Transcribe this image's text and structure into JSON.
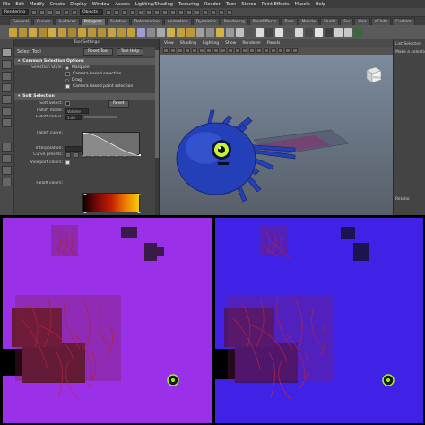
{
  "menu": {
    "items": [
      "File",
      "Edit",
      "Modify",
      "Create",
      "Display",
      "Window",
      "Assets",
      "Lighting/Shading",
      "Texturing",
      "Render",
      "Toon",
      "Stereo",
      "Paint Effects",
      "Muscle",
      "Help"
    ]
  },
  "statusline": {
    "mode": "Rendering",
    "selection_mask": "Objects"
  },
  "shelf": {
    "tabs": [
      "General",
      "Curves",
      "Surfaces",
      "Polygons",
      "Subdivs",
      "Deformation",
      "Animation",
      "Dynamics",
      "Rendering",
      "PaintEffects",
      "Toon",
      "Muscle",
      "Fluids",
      "Fur",
      "Hair",
      "nCloth",
      "Custom"
    ],
    "active_tab": "Polygons"
  },
  "tool_settings": {
    "header": "Tool Settings",
    "tool_name": "Select Tool",
    "reset_label": "Reset Tool",
    "help_label": "Tool Help",
    "common_section": "Common Selection Options",
    "selection_style_label": "Selection Style:",
    "marquee_label": "Marquee",
    "camera_based_label": "Camera based selection",
    "drag_label": "Drag",
    "camera_paint_label": "Camera based paint selection",
    "soft_section": "Soft Selection",
    "soft_select_label": "Soft Select:",
    "reset_button": "Reset",
    "falloff_mode_label": "Falloff mode:",
    "falloff_mode_value": "Volume",
    "falloff_radius_label": "Falloff radius:",
    "falloff_radius_value": "5.00",
    "falloff_curve_label": "Falloff curve:",
    "interpolation_label": "Interpolation:",
    "curve_presets_label": "Curve presets:",
    "viewport_colors_label": "Viewport colors:",
    "falloff_colors_label": "Falloff colors:"
  },
  "viewport": {
    "menu": [
      "View",
      "Shading",
      "Lighting",
      "Show",
      "Renderer",
      "Panels"
    ],
    "viewcube_label": "FRONT"
  },
  "channel_box": {
    "tab": "List",
    "tab2": "Selected",
    "hint": "Make a selection",
    "footer": "Relatio"
  },
  "colors": {
    "left_pass_bg": "#9a31e8",
    "right_pass_bg": "#3f22e6",
    "viewport_top": "#7f8fa2",
    "model_blue": "#2340b8",
    "eye_green": "#c8f232"
  }
}
